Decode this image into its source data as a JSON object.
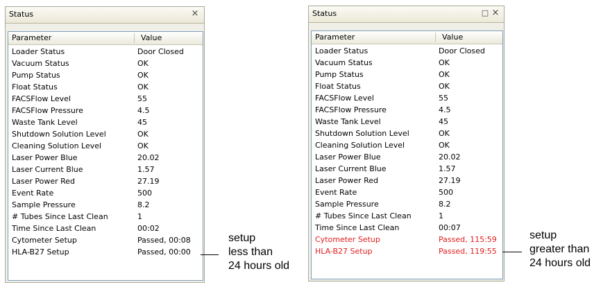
{
  "left_panel": {
    "title": "Status",
    "close_glyph": "×",
    "columns": [
      "Parameter",
      "Value"
    ],
    "rows": [
      {
        "param": "Loader Status",
        "value": "Door Closed"
      },
      {
        "param": "Vacuum Status",
        "value": "OK"
      },
      {
        "param": "Pump Status",
        "value": "OK"
      },
      {
        "param": "Float Status",
        "value": "OK"
      },
      {
        "param": "FACSFlow Level",
        "value": "55"
      },
      {
        "param": "FACSFlow Pressure",
        "value": "4.5"
      },
      {
        "param": "Waste Tank Level",
        "value": "45"
      },
      {
        "param": "Shutdown Solution Level",
        "value": "OK"
      },
      {
        "param": "Cleaning Solution Level",
        "value": "OK"
      },
      {
        "param": "Laser Power Blue",
        "value": "20.02"
      },
      {
        "param": "Laser Current Blue",
        "value": "1.57"
      },
      {
        "param": "Laser Power Red",
        "value": "27.19"
      },
      {
        "param": "Event Rate",
        "value": "500"
      },
      {
        "param": "Sample Pressure",
        "value": "8.2"
      },
      {
        "param": "# Tubes Since Last Clean",
        "value": "1"
      },
      {
        "param": "Time Since Last Clean",
        "value": "00:02"
      },
      {
        "param": "Cytometer Setup",
        "value": "Passed, 00:08"
      },
      {
        "param": "HLA-B27 Setup",
        "value": "Passed, 00:00"
      }
    ]
  },
  "right_panel": {
    "title": "Status",
    "restore_glyph": "□",
    "close_glyph": "×",
    "columns": [
      "Parameter",
      "Value"
    ],
    "rows": [
      {
        "param": "Loader Status",
        "value": "Door Closed"
      },
      {
        "param": "Vacuum Status",
        "value": "OK"
      },
      {
        "param": "Pump Status",
        "value": "OK"
      },
      {
        "param": "Float Status",
        "value": "OK"
      },
      {
        "param": "FACSFlow Level",
        "value": "55"
      },
      {
        "param": "FACSFlow Pressure",
        "value": "4.5"
      },
      {
        "param": "Waste Tank Level",
        "value": "45"
      },
      {
        "param": "Shutdown Solution Level",
        "value": "OK"
      },
      {
        "param": "Cleaning Solution Level",
        "value": "OK"
      },
      {
        "param": "Laser Power Blue",
        "value": "20.02"
      },
      {
        "param": "Laser Current Blue",
        "value": "1.57"
      },
      {
        "param": "Laser Power Red",
        "value": "27.19"
      },
      {
        "param": "Event Rate",
        "value": "500"
      },
      {
        "param": "Sample Pressure",
        "value": "8.2"
      },
      {
        "param": "# Tubes Since Last Clean",
        "value": "1"
      },
      {
        "param": "Time Since Last Clean",
        "value": "00:07"
      },
      {
        "param": "Cytometer Setup",
        "value": "Passed, 115:59",
        "alert": true
      },
      {
        "param": "HLA-B27 Setup",
        "value": "Passed, 119:55",
        "alert": true
      }
    ]
  },
  "annotations": {
    "left": [
      "setup",
      "less than",
      "24 hours old"
    ],
    "right": [
      "setup",
      "greater than",
      "24 hours old"
    ]
  },
  "colors": {
    "alert_text": "#e21d1d",
    "panel_bg": "#f0efe7"
  }
}
